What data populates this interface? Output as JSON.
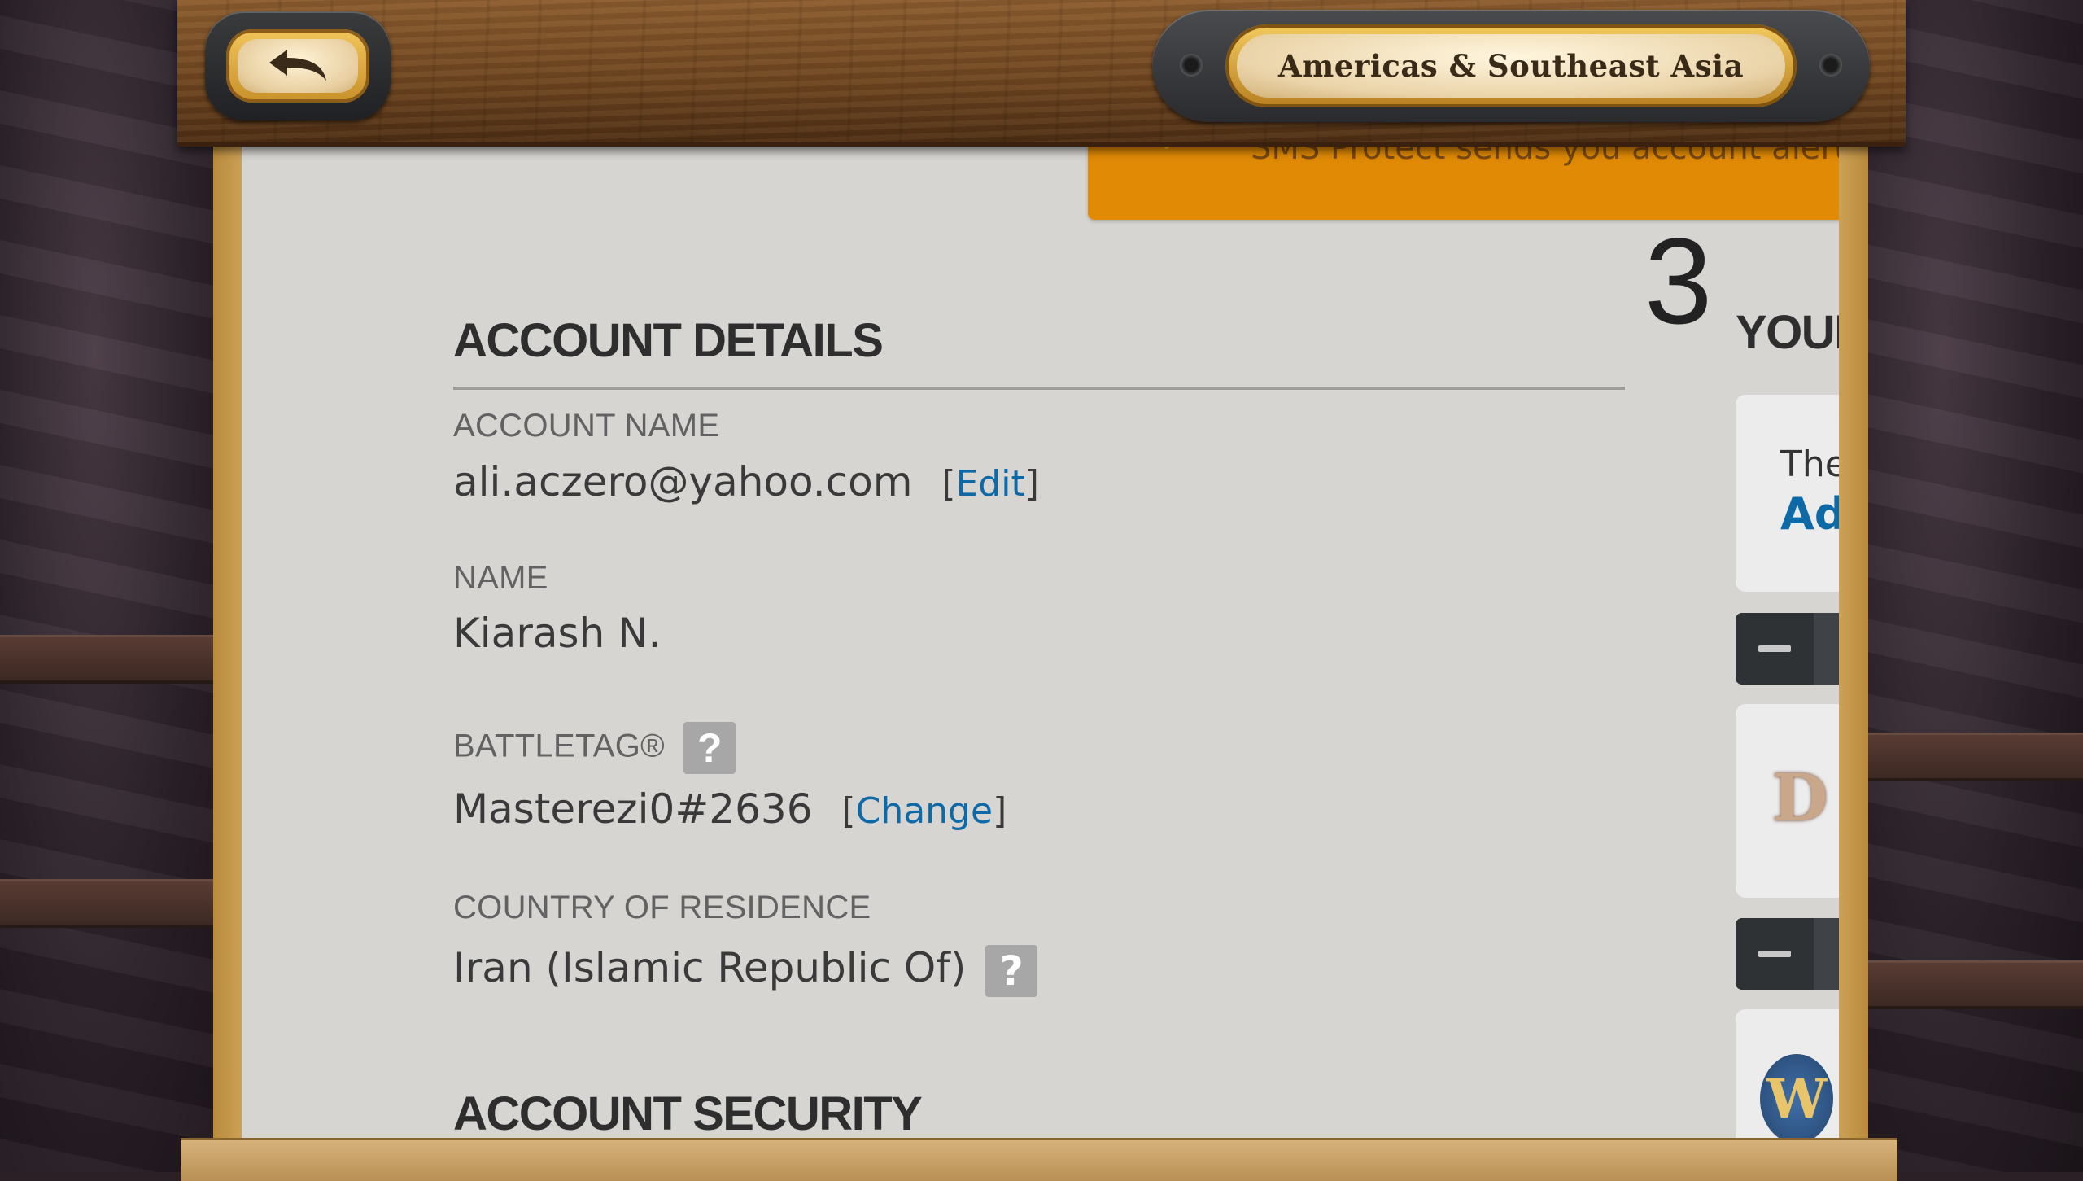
{
  "topbar": {
    "back_icon": "back-arrow-icon",
    "region_label": "Americas & Southeast Asia"
  },
  "banner": {
    "text": "SMS Protect sends you account alerts"
  },
  "step_number": "3",
  "account_details": {
    "title": "ACCOUNT DETAILS",
    "account_name_label": "ACCOUNT NAME",
    "account_name_value": "ali.aczero@yahoo.com",
    "edit_link": "Edit",
    "name_label": "NAME",
    "name_value": "Kiarash N.",
    "battletag_label": "BATTLETAG®",
    "battletag_value": "Masterezi0#2636",
    "change_link": "Change",
    "country_label": "COUNTRY OF RESIDENCE",
    "country_value": "Iran (Islamic Republic Of)",
    "help_icon_glyph": "?"
  },
  "account_security": {
    "title": "ACCOUNT SECURITY"
  },
  "right_column": {
    "title": "YOUR",
    "card_text": "The",
    "card_link": "Ad",
    "game_logo_1": "D",
    "game_logo_2": "W"
  },
  "colors": {
    "link": "#0e6aa6",
    "banner": "#e08a06",
    "page_bg": "#d6d5d2"
  }
}
